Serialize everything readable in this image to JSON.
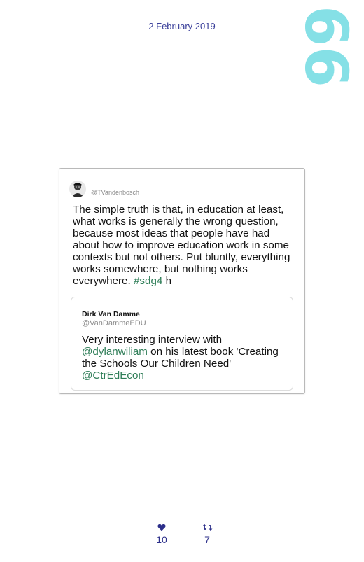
{
  "page": {
    "date": "2 February 2019",
    "number": "66"
  },
  "tweet": {
    "handle": "@TVandenbosch",
    "text_main": "The simple truth is that, in education at least, what works is generally the wrong question, because most ideas that people have had about how to improve education work in some contexts but not others. Put bluntly, everything works somewhere, but nothing works everywhere. ",
    "hashtag": "#sdg4",
    "text_tail": " h",
    "avatar_icon": "user-avatar"
  },
  "quoted_tweet": {
    "name": "Dirk Van Damme",
    "handle": "@VanDammeEDU",
    "text_part1": "Very interesting interview with ",
    "mention1": "@dylanwiliam",
    "text_part2": " on his latest book 'Creating the Schools Our Children Need' ",
    "mention2": "@CtrEdEcon"
  },
  "stats": {
    "likes": "10",
    "retweets": "7",
    "like_icon": "heart-icon",
    "retweet_icon": "retweet-icon"
  },
  "colors": {
    "date_text": "#3a3f9a",
    "page_number": "#85e0e6",
    "link": "#2e7d57",
    "stats": "#2c2f8a"
  }
}
